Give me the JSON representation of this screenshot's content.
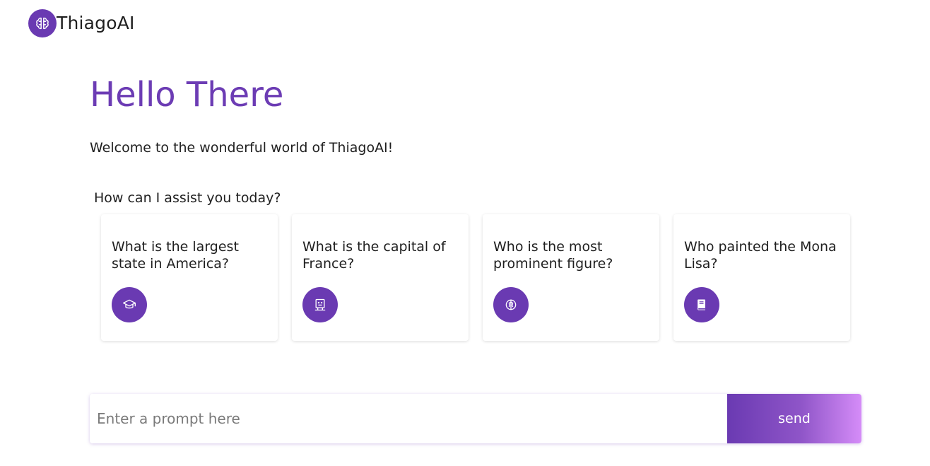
{
  "header": {
    "app_name": "ThiagoAI",
    "logo_icon": "brain-icon"
  },
  "hero": {
    "title": "Hello There",
    "welcome": "Welcome to the wonderful world of ThiagoAI!",
    "assist_prompt": "How can I assist you today?"
  },
  "cards": [
    {
      "text": "What is the largest state in America?",
      "icon": "graduation-cap-icon"
    },
    {
      "text": "What is the capital of France?",
      "icon": "robot-icon"
    },
    {
      "text": "Who is the most prominent figure?",
      "icon": "brain-icon"
    },
    {
      "text": "Who painted the Mona Lisa?",
      "icon": "book-icon"
    }
  ],
  "prompt": {
    "placeholder": "Enter a prompt here",
    "value": "",
    "send_label": "send"
  },
  "colors": {
    "accent": "#6a3ab2",
    "title": "#6c3cb4",
    "send_gradient_end": "#d58cf8"
  }
}
